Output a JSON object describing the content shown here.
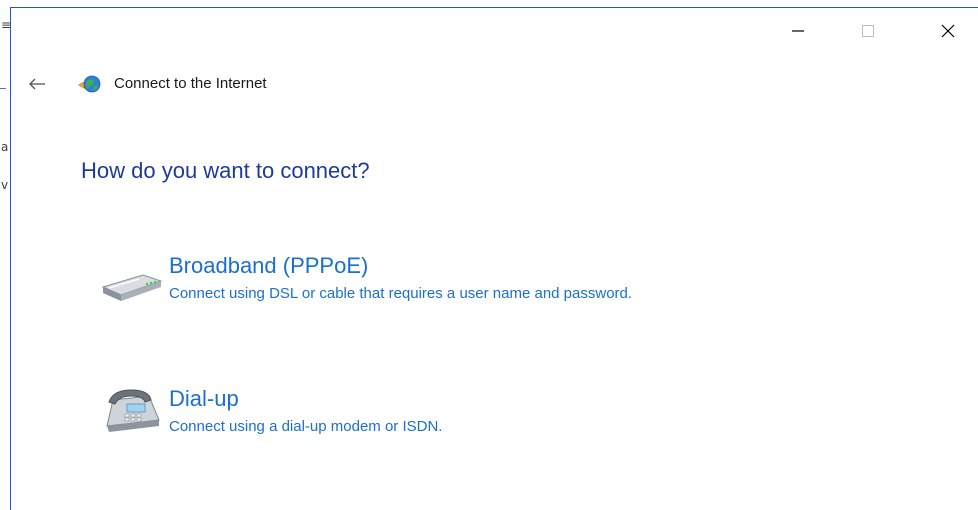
{
  "window": {
    "minimize_icon": "minimize-icon",
    "maximize_icon": "maximize-icon",
    "close_icon": "close-icon"
  },
  "header": {
    "back_icon": "back-arrow-icon",
    "app_icon": "network-globe-icon",
    "title": "Connect to the Internet"
  },
  "main": {
    "heading": "How do you want to connect?",
    "options": [
      {
        "icon": "broadband-modem-icon",
        "title": "Broadband (PPPoE)",
        "description": "Connect using DSL or cable that requires a user name and password."
      },
      {
        "icon": "dialup-phone-icon",
        "title": "Dial-up",
        "description": "Connect using a dial-up modem or ISDN."
      }
    ]
  },
  "colors": {
    "heading": "#1e3a9c",
    "link": "#1a6fd0",
    "window_border": "#2b4fd6"
  }
}
